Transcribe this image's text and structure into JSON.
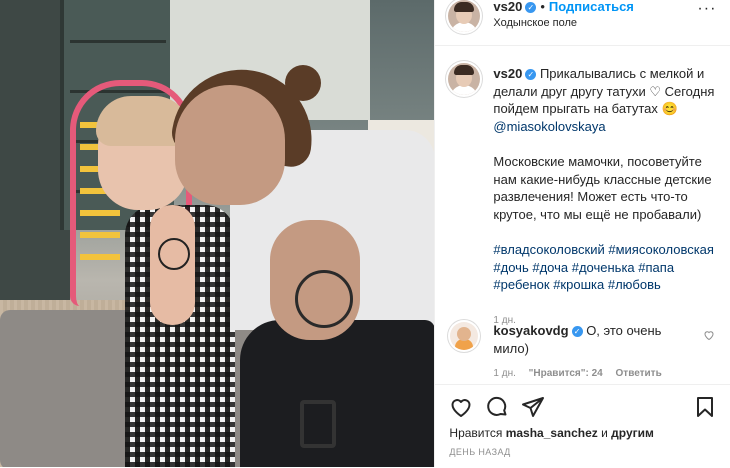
{
  "post": {
    "username": "vs20",
    "verified_icon": "verified-badge-icon",
    "separator": "•",
    "follow_label": "Подписаться",
    "location": "Ходынское поле",
    "more_label": "···"
  },
  "caption": {
    "username": "vs20",
    "text_main": "Прикалывались с мелкой и делали друг другу татухи ♡ Сегодня пойдем прыгать на батутах 😊",
    "mention": "@miasokolovskaya",
    "paragraph2": "Московские мамочки, посоветуйте нам какие-нибудь классные детские развлечения! Может есть что-то крутое, что мы ещё не пробавали)",
    "hashtags": [
      "#владсоколовский",
      "#миясоколовская",
      "#дочь",
      "#доча",
      "#доченька",
      "#папа",
      "#ребенок",
      "#крошка",
      "#любовь"
    ],
    "age": "1 дн."
  },
  "comment": {
    "username": "kosyakovdg",
    "text": "О, это очень мило)",
    "age": "1 дн.",
    "likes": "\"Нравится\": 24",
    "reply_label": "Ответить"
  },
  "actions": {
    "icons": [
      "heart-icon",
      "comment-icon",
      "share-icon",
      "bookmark-icon"
    ],
    "likes_prefix": "Нравится",
    "likes_user": "masha_sanchez",
    "likes_conj": "и",
    "likes_others": "другим",
    "timeago": "ДЕНЬ НАЗАД"
  },
  "colors": {
    "link": "#00376b",
    "follow": "#0095f6",
    "muted": "#8e8e8e",
    "verified": "#3897f0"
  }
}
